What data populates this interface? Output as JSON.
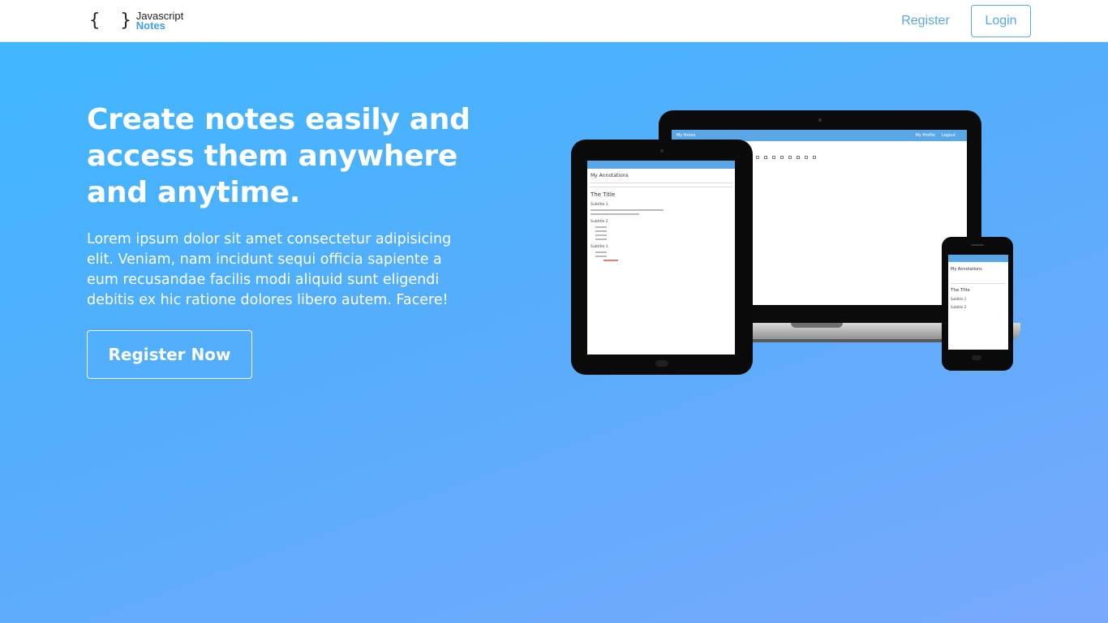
{
  "navbar": {
    "brand": {
      "braces": "{ }",
      "line1": "Javascript",
      "line2": "Notes"
    },
    "register_label": "Register",
    "login_label": "Login"
  },
  "hero": {
    "title": "Create notes easily and access them anywhere and anytime.",
    "text": "Lorem ipsum dolor sit amet consectetur adipisicing elit. Veniam, nam incidunt sequi officia sapiente a eum recusandae facilis modi aliquid sunt eligendi debitis ex hic ratione dolores libero autem. Facere!",
    "cta_label": "Register Now"
  },
  "devices": {
    "laptop_screen": {
      "bar_left": "My Notes",
      "bar_right_1": "My Profile",
      "bar_right_2": "Logout"
    },
    "tablet_screen": {
      "heading": "My Annotations",
      "title": "The Title",
      "sub1": "Subtitle 1",
      "sub2": "Subtitle 2",
      "sub3": "Subtitle 3"
    },
    "phone_screen": {
      "heading": "My Annotations",
      "title": "The Title",
      "sub1": "Subtitle 1",
      "sub2": "Subtitle 2"
    }
  },
  "colors": {
    "accent": "#5aa7e8",
    "brand_notes": "#3f9ee6",
    "hero_start": "#3fb7fe",
    "hero_end": "#79a9fd"
  }
}
